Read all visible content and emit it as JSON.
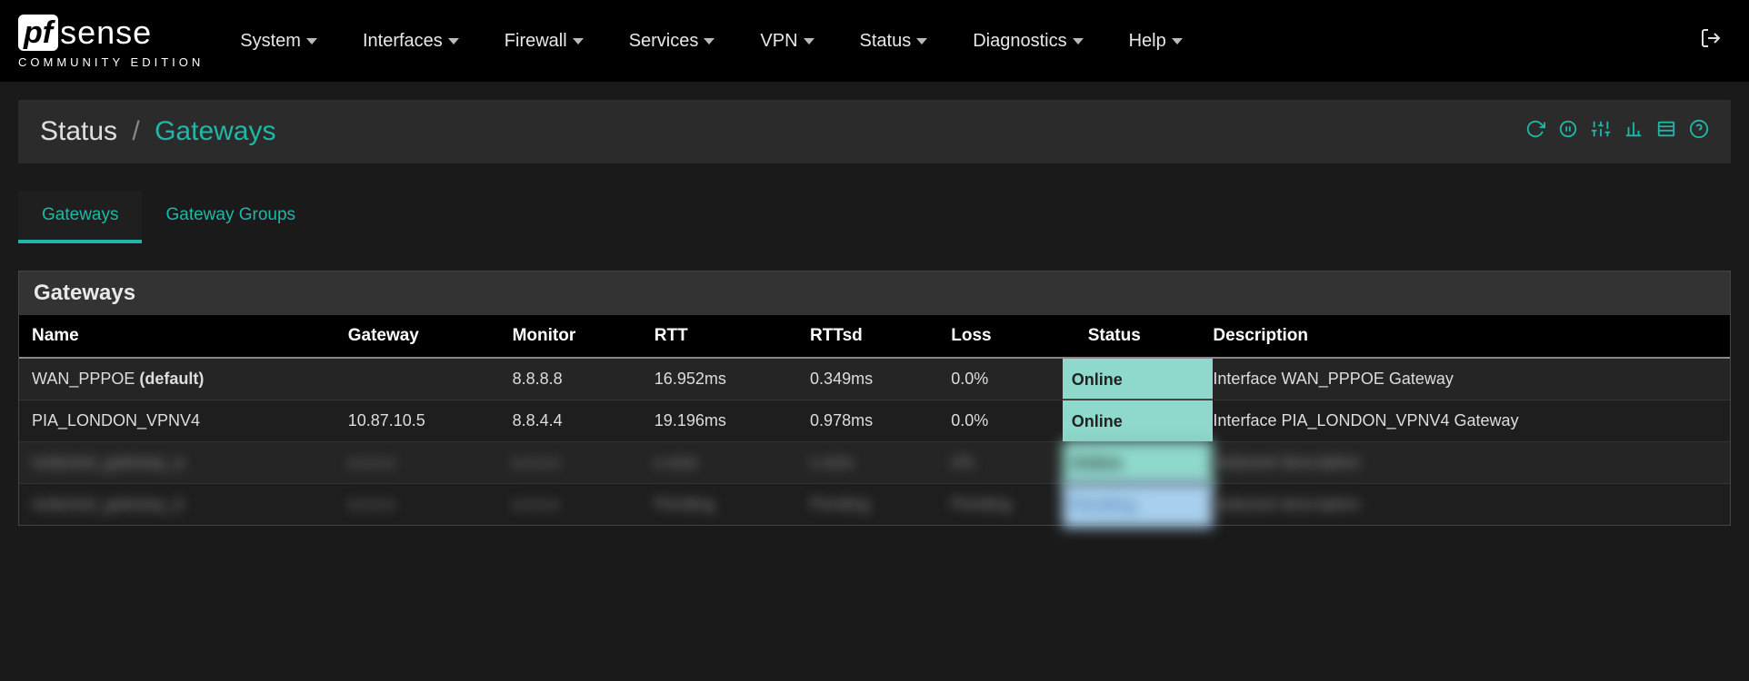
{
  "logo": {
    "pf": "pf",
    "sense": "sense",
    "sub": "COMMUNITY EDITION"
  },
  "nav": {
    "items": [
      {
        "label": "System"
      },
      {
        "label": "Interfaces"
      },
      {
        "label": "Firewall"
      },
      {
        "label": "Services"
      },
      {
        "label": "VPN"
      },
      {
        "label": "Status"
      },
      {
        "label": "Diagnostics"
      },
      {
        "label": "Help"
      }
    ]
  },
  "breadcrumb": {
    "section": "Status",
    "page": "Gateways"
  },
  "tabs": [
    {
      "label": "Gateways",
      "active": true
    },
    {
      "label": "Gateway Groups",
      "active": false
    }
  ],
  "panel": {
    "title": "Gateways",
    "columns": [
      "Name",
      "Gateway",
      "Monitor",
      "RTT",
      "RTTsd",
      "Loss",
      "Status",
      "Description"
    ],
    "rows": [
      {
        "name": "WAN_PPPOE",
        "default": "(default)",
        "gateway": "",
        "monitor": "8.8.8.8",
        "rtt": "16.952ms",
        "rttsd": "0.349ms",
        "loss": "0.0%",
        "status": "Online",
        "description": "Interface WAN_PPPOE Gateway",
        "blurred": false
      },
      {
        "name": "PIA_LONDON_VPNV4",
        "default": "",
        "gateway": "10.87.10.5",
        "monitor": "8.8.4.4",
        "rtt": "19.196ms",
        "rttsd": "0.978ms",
        "loss": "0.0%",
        "status": "Online",
        "description": "Interface PIA_LONDON_VPNV4 Gateway",
        "blurred": false
      },
      {
        "name": "redacted_gateway_a",
        "default": "",
        "gateway": "x.x.x.x",
        "monitor": "x.x.x.x",
        "rtt": "x.xms",
        "rttsd": "x.xms",
        "loss": "x%",
        "status": "Online",
        "description": "redacted description",
        "blurred": true
      },
      {
        "name": "redacted_gateway_b",
        "default": "",
        "gateway": "x.x.x.x",
        "monitor": "x.x.x.x",
        "rtt": "Pending",
        "rttsd": "Pending",
        "loss": "Pending",
        "status": "Pending",
        "description": "redacted description",
        "blurred": true
      }
    ]
  }
}
